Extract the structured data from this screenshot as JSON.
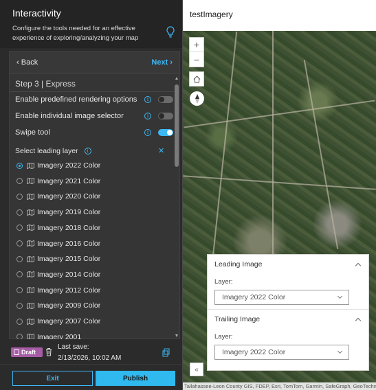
{
  "header": {
    "title": "Interactivity",
    "description": "Configure the tools needed for an effective experience of exploring/analyzing your map"
  },
  "nav": {
    "back_label": "Back",
    "next_label": "Next"
  },
  "step": {
    "title": "Step 3 | Express",
    "options": [
      {
        "label": "Enable predefined rendering options",
        "enabled": false
      },
      {
        "label": "Enable individual image selector",
        "enabled": false
      },
      {
        "label": "Swipe tool",
        "enabled": true
      }
    ],
    "leading_layer_label": "Select leading layer",
    "layers": [
      {
        "label": "Imagery 2022 Color",
        "selected": true
      },
      {
        "label": "Imagery 2021 Color",
        "selected": false
      },
      {
        "label": "Imagery 2020 Color",
        "selected": false
      },
      {
        "label": "Imagery 2019 Color",
        "selected": false
      },
      {
        "label": "Imagery 2018 Color",
        "selected": false
      },
      {
        "label": "Imagery 2016 Color",
        "selected": false
      },
      {
        "label": "Imagery 2015 Color",
        "selected": false
      },
      {
        "label": "Imagery 2014 Color",
        "selected": false
      },
      {
        "label": "Imagery 2012 Color",
        "selected": false
      },
      {
        "label": "Imagery 2009 Color",
        "selected": false
      },
      {
        "label": "Imagery 2007 Color",
        "selected": false
      },
      {
        "label": "Imagery 2001",
        "selected": false
      }
    ]
  },
  "save": {
    "draft_label": "Draft",
    "last_save_label": "Last save:",
    "last_save_date": "2/13/2026, 10:02 AM"
  },
  "actions": {
    "exit_label": "Exit",
    "publish_label": "Publish"
  },
  "map": {
    "title": "testImagery",
    "zoom_in": "+",
    "zoom_out": "−",
    "attribution": "Tallahassee-Leon County GIS, FDEP, Esri, TomTom, Garmin, SafeGraph, GeoTechnologies"
  },
  "swipe": {
    "leading_title": "Leading Image",
    "trailing_title": "Trailing Image",
    "layer_label": "Layer:",
    "leading_value": "Imagery 2022 Color",
    "trailing_value": "Imagery 2022 Color"
  },
  "colors": {
    "accent": "#3db8f5",
    "draft": "#a65ca5",
    "panel_bg": "#2b2b2b"
  }
}
